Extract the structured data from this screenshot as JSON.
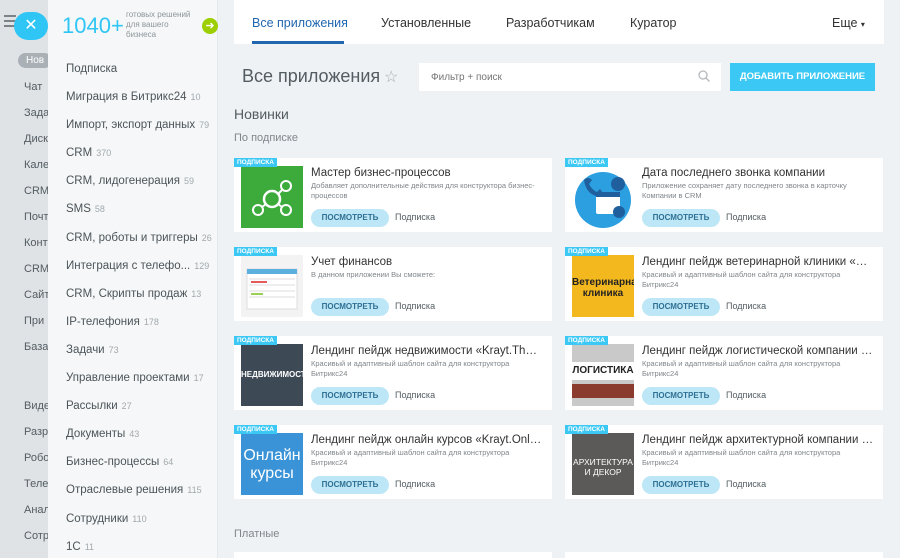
{
  "bg_menu": {
    "items": [
      "Нов",
      "Чат",
      "Зада",
      "Диск",
      "Кале",
      "CRM",
      "Почт",
      "Конт",
      "CRM",
      "Сайт",
      "При",
      "База",
      "Виде",
      "Разр",
      "Робо",
      "Теле",
      "Анал",
      "Сотр"
    ]
  },
  "catalog": {
    "count": "1040+",
    "count_text": "готовых решений для вашего бизнеса",
    "categories": [
      {
        "label": "Подписка",
        "count": ""
      },
      {
        "label": "Миграция в Битрикс24",
        "count": "10"
      },
      {
        "label": "Импорт, экспорт данных",
        "count": "79"
      },
      {
        "label": "CRM",
        "count": "370"
      },
      {
        "label": "CRM, лидогенерация",
        "count": "59"
      },
      {
        "label": "SMS",
        "count": "58"
      },
      {
        "label": "CRM, роботы и триггеры",
        "count": "26"
      },
      {
        "label": "Интеграция с телефо...",
        "count": "129"
      },
      {
        "label": "CRM, Скрипты продаж",
        "count": "13"
      },
      {
        "label": "IP-телефония",
        "count": "178"
      },
      {
        "label": "Задачи",
        "count": "73"
      },
      {
        "label": "Управление проектами",
        "count": "17"
      },
      {
        "label": "Рассылки",
        "count": "27"
      },
      {
        "label": "Документы",
        "count": "43"
      },
      {
        "label": "Бизнес-процессы",
        "count": "64"
      },
      {
        "label": "Отраслевые решения",
        "count": "115"
      },
      {
        "label": "Сотрудники",
        "count": "110"
      },
      {
        "label": "1С",
        "count": "11"
      }
    ]
  },
  "tabs": [
    "Все приложения",
    "Установленные",
    "Разработчикам",
    "Куратор",
    "Еще"
  ],
  "page_title": "Все приложения",
  "filter_placeholder": "Фильтр + поиск",
  "add_button": "ДОБАВИТЬ ПРИЛОЖЕНИЕ",
  "section_title": "Новинки",
  "sub_title": "По подписке",
  "paid_title": "Платные",
  "cards": [
    {
      "badge": "ПОДПИСКА",
      "title": "Мастер бизнес-процессов",
      "desc": "Добавляет дополнительные действия для конструктора бизнес-процессов",
      "button": "ПОСМОТРЕТЬ",
      "label": "Подписка",
      "thumb": ""
    },
    {
      "badge": "ПОДПИСКА",
      "title": "Дата последнего звонка компании",
      "desc": "Приложение сохраняет дату последнего звонка в карточку Компании в CRM",
      "button": "ПОСМОТРЕТЬ",
      "label": "Подписка",
      "thumb": ""
    },
    {
      "badge": "ПОДПИСКА",
      "title": "Учет финансов",
      "desc": "В данном приложении Вы сможете:",
      "button": "ПОСМОТРЕТЬ",
      "label": "Подписка",
      "thumb": ""
    },
    {
      "badge": "ПОДПИСКА",
      "title": "Лендинг пейдж ветеринарной клиники «Kr...",
      "desc": "Красивый и адаптивный шаблон сайта для конструктора Битрикс24",
      "button": "ПОСМОТРЕТЬ",
      "label": "Подписка",
      "thumb": "Ветеринарная клиника"
    },
    {
      "badge": "ПОДПИСКА",
      "title": "Лендинг пейдж недвижимости «Krayt.ThePr...",
      "desc": "Красивый и адаптивный шаблон сайта для конструктора Битрикс24",
      "button": "ПОСМОТРЕТЬ",
      "label": "Подписка",
      "thumb": "НЕДВИЖИМОСТЬ"
    },
    {
      "badge": "ПОДПИСКА",
      "title": "Лендинг пейдж логистической компании «...",
      "desc": "Красивый и адаптивный шаблон сайта для конструктора Битрикс24",
      "button": "ПОСМОТРЕТЬ",
      "label": "Подписка",
      "thumb": "ЛОГИСТИКА"
    },
    {
      "badge": "ПОДПИСКА",
      "title": "Лендинг пейдж онлайн курсов «Krayt.Online...",
      "desc": "Красивый и адаптивный шаблон сайта для конструктора Битрикс24",
      "button": "ПОСМОТРЕТЬ",
      "label": "Подписка",
      "thumb": "Онлайн курсы"
    },
    {
      "badge": "ПОДПИСКА",
      "title": "Лендинг пейдж архитектурной компании «...",
      "desc": "Красивый и адаптивный шаблон сайта для конструктора Битрикс24",
      "button": "ПОСМОТРЕТЬ",
      "label": "Подписка",
      "thumb": "АРХИТЕКТУРА И ДЕКОР"
    }
  ]
}
